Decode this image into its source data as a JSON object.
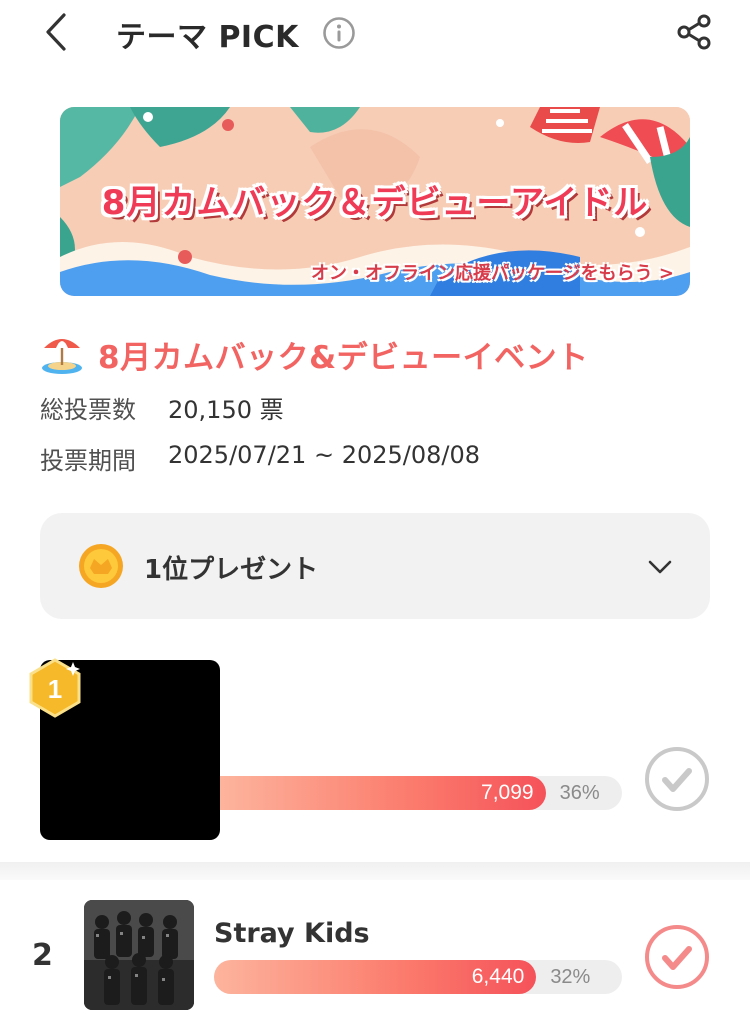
{
  "header": {
    "title": "テーマ PICK",
    "back_icon": "chevron-left-icon",
    "info_icon": "info-circle-icon",
    "share_icon": "share-icon"
  },
  "banner": {
    "title": "8月カムバック＆デビューアイドル",
    "subtitle": "オン・オフライン応援パッケージをもらう >"
  },
  "event": {
    "emoji_icon": "beach-umbrella-icon",
    "title": "8月カムバック&デビューイベント",
    "votes_label": "総投票数",
    "votes_value": "20,150 票",
    "period_label": "投票期間",
    "period_value": "2025/07/21 ~ 2025/08/08"
  },
  "present": {
    "label": "1位プレゼント",
    "icon": "gold-coin-icon",
    "toggle_icon": "chevron-down-icon"
  },
  "rankings": [
    {
      "rank": "1",
      "name": "",
      "votes": "7,099",
      "percent": "36%",
      "fill": 0.81
    },
    {
      "rank": "2",
      "name": "Stray Kids",
      "votes": "6,440",
      "percent": "32%",
      "fill": 0.79
    }
  ],
  "colors": {
    "accent": "#f26462",
    "bar_start": "#fdb49d",
    "bar_end": "#f5525a",
    "check_inactive": "#c9c9c9",
    "check_active": "#f58a8a",
    "medal": "#f6b929"
  }
}
